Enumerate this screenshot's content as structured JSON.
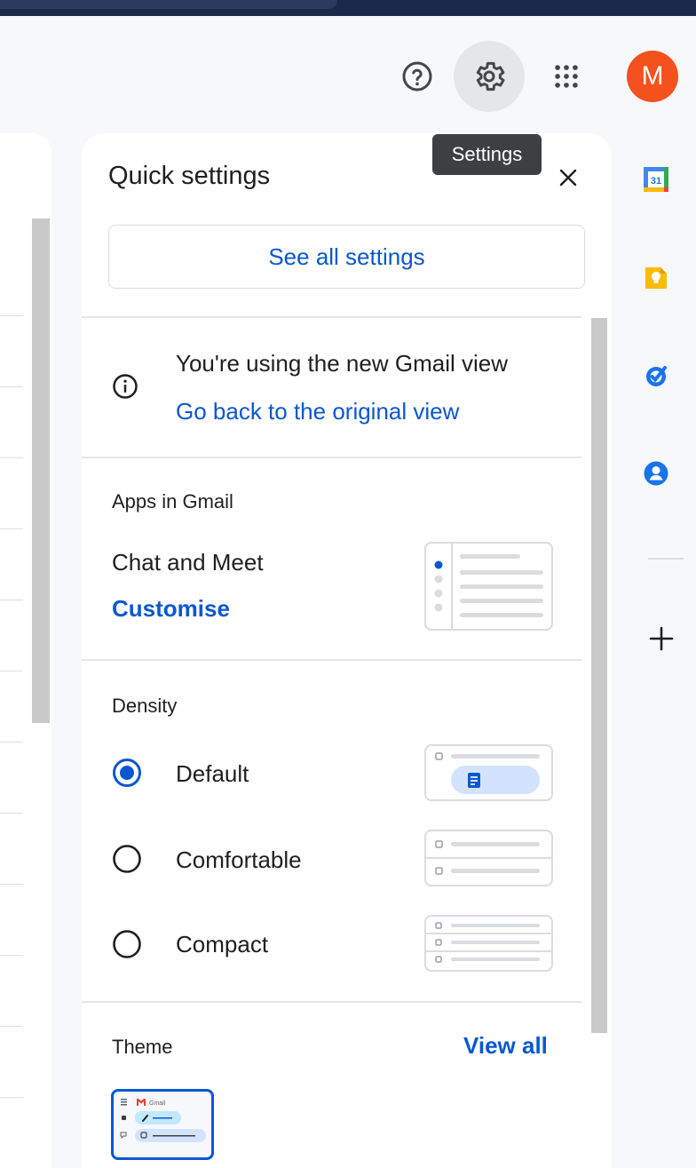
{
  "topbar": {
    "avatar_initial": "M",
    "tooltip": "Settings"
  },
  "quick_settings": {
    "title": "Quick settings",
    "see_all_label": "See all settings",
    "view_notice": {
      "text": "You're using the new Gmail view",
      "link": "Go back to the original view"
    },
    "apps": {
      "label": "Apps in Gmail",
      "item": "Chat and Meet",
      "link": "Customise"
    },
    "density": {
      "label": "Density",
      "options": [
        {
          "label": "Default",
          "selected": true
        },
        {
          "label": "Comfortable",
          "selected": false
        },
        {
          "label": "Compact",
          "selected": false
        }
      ]
    },
    "theme": {
      "label": "Theme",
      "view_all": "View all",
      "thumb_brand": "Gmail"
    }
  },
  "side_panel": {
    "calendar_day": "31",
    "icons": [
      "calendar-icon",
      "keep-icon",
      "tasks-icon",
      "contacts-icon",
      "add-icon"
    ]
  },
  "colors": {
    "accent": "#0b57d0",
    "avatar": "#f4511e",
    "tooltip_bg": "#3c4043"
  }
}
